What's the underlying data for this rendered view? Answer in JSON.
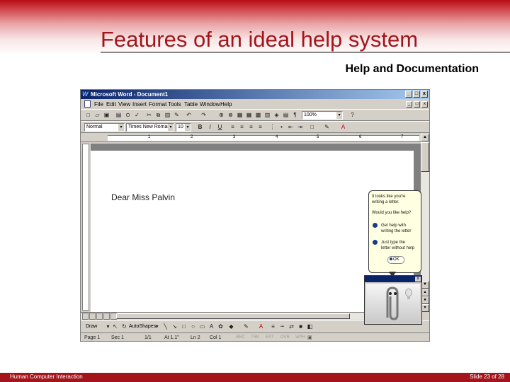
{
  "slide": {
    "title": "Features of an ideal help system",
    "subtitle": "Help and Documentation",
    "footer_left": "Human Computer Interaction",
    "footer_right": "Slide 23 of 28"
  },
  "word": {
    "app_icon": "W",
    "window_title": "Microsoft Word - Document1",
    "window_buttons": [
      "_",
      "□",
      "x"
    ],
    "menu": [
      "File",
      "Edit",
      "View",
      "Insert",
      "Format",
      "Tools",
      "Table",
      "Window",
      "Help"
    ],
    "doc_buttons": [
      "_",
      "□",
      "x"
    ],
    "zoom": "100%",
    "style": "Normal",
    "font": "Times New Roman",
    "font_size": "10",
    "format_buttons": [
      "B",
      "I",
      "U"
    ],
    "ruler_numbers": [
      "1",
      "2",
      "3",
      "4",
      "5",
      "6",
      "7"
    ],
    "document_text": "Dear Miss Palvin",
    "draw_label": "Draw",
    "autoshapes_label": "AutoShapes",
    "status": {
      "page": "Page 1",
      "sec": "Sec 1",
      "pages": "1/1",
      "at": "At 1.1\"",
      "ln": "Ln 2",
      "col": "Col 1",
      "modes": [
        "REC",
        "TRK",
        "EXT",
        "OVR",
        "WPH"
      ]
    }
  },
  "assistant": {
    "balloon_line1": "It looks like you're",
    "balloon_line2": "writing a letter.",
    "question": "Would you like help?",
    "option1_line1": "Get help with",
    "option1_line2": "writing the letter",
    "option2_line1": "Just type the",
    "option2_line2": "letter without help",
    "ok": "OK",
    "close": "x"
  }
}
